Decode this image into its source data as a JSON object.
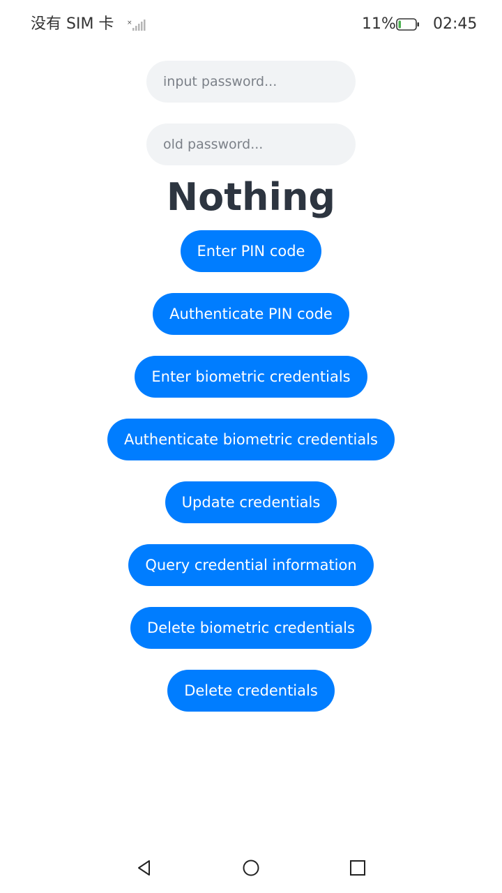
{
  "status_bar": {
    "carrier": "没有 SIM 卡",
    "battery": "11%",
    "time": "02:45",
    "icons": [
      "signal-icon",
      "battery-icon"
    ]
  },
  "form": {
    "password_placeholder": "input password...",
    "password_value": "",
    "old_password_placeholder": "old password...",
    "old_password_value": ""
  },
  "status": {
    "text": "Nothing"
  },
  "buttons": [
    {
      "label": "Enter PIN code"
    },
    {
      "label": "Authenticate PIN code"
    },
    {
      "label": "Enter biometric credentials"
    },
    {
      "label": "Authenticate biometric credentials"
    },
    {
      "label": "Update credentials"
    },
    {
      "label": "Query credential information"
    },
    {
      "label": "Delete biometric credentials"
    },
    {
      "label": "Delete credentials"
    }
  ],
  "nav_bar": {
    "icons": [
      "back-icon",
      "home-icon",
      "recent-apps-icon"
    ]
  },
  "colors": {
    "accent": "#007dff",
    "input_bg": "#f1f3f5",
    "title": "#2d3540",
    "battery_fill": "#4caf50"
  }
}
